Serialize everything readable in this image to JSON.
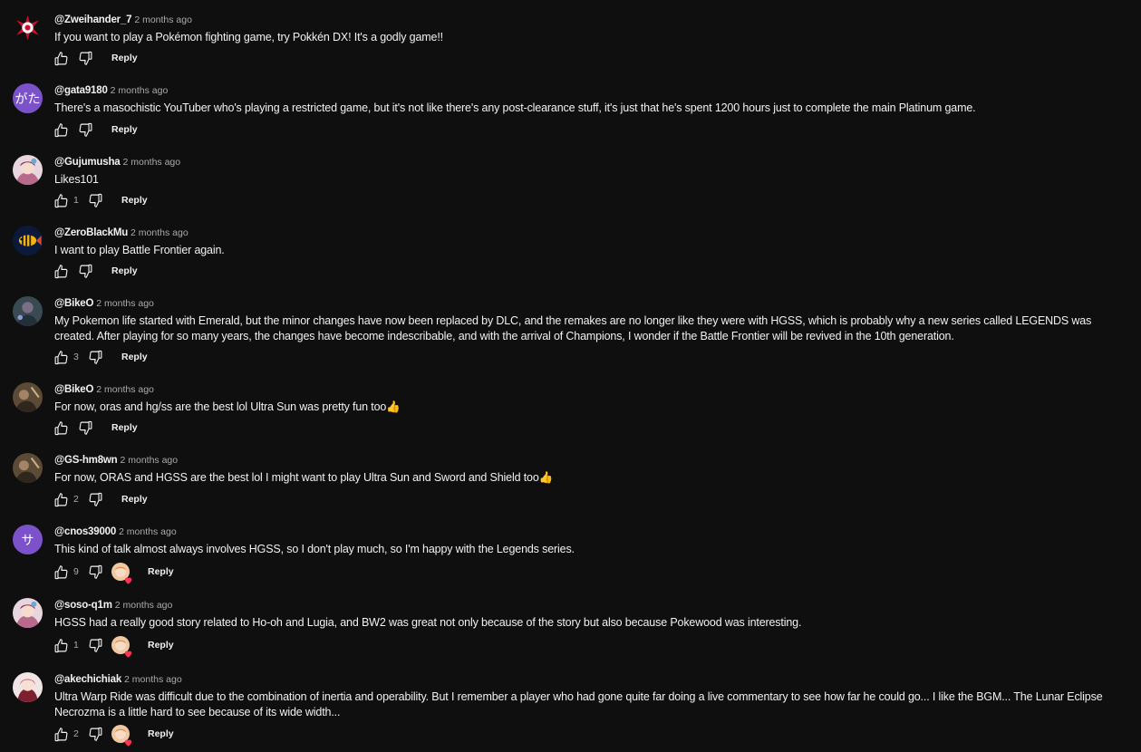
{
  "labels": {
    "reply": "Reply"
  },
  "colors": {
    "background": "#0f0f0f",
    "text": "#f1f1f1",
    "muted": "#aaaaaa",
    "avatar_purple": "#7b52c9",
    "heart_red": "#ff3355"
  },
  "comments": [
    {
      "author": "@Zweihander_7",
      "time": "2 months ago",
      "text": "If you want to play a Pokémon fighting game, try Pokkén DX! It's a godly game!!",
      "likes": "",
      "avatar": {
        "kind": "icon",
        "icon": "red-emblem-avatar"
      },
      "creator_heart": false
    },
    {
      "author": "@gata9180",
      "time": "2 months ago",
      "text": "There's a masochistic YouTuber who's playing a restricted game, but it's not like there's any post-clearance stuff, it's just that he's spent 1200 hours just to complete the main Platinum game.",
      "likes": "",
      "avatar": {
        "kind": "letter",
        "letter": "がた",
        "color": "#7b52c9"
      },
      "creator_heart": false
    },
    {
      "author": "@Gujumusha",
      "time": "2 months ago",
      "text": "Likes101",
      "likes": "1",
      "avatar": {
        "kind": "icon",
        "icon": "anime-avatar"
      },
      "creator_heart": false
    },
    {
      "author": "@ZeroBlackMu",
      "time": "2 months ago",
      "text": "I want to play Battle Frontier again.",
      "likes": "",
      "avatar": {
        "kind": "icon",
        "icon": "fish-avatar"
      },
      "creator_heart": false
    },
    {
      "author": "@BikeO",
      "time": "2 months ago",
      "text": "My Pokemon life started with Emerald, but the minor changes have now been replaced by DLC, and the remakes are no longer like they were with HGSS, which is probably why a new series called LEGENDS was created. After playing for so many years, the changes have become indescribable, and with the arrival of Champions, I wonder if the Battle Frontier will be revived in the 10th generation.",
      "likes": "3",
      "avatar": {
        "kind": "icon",
        "icon": "dark-figure-avatar"
      },
      "creator_heart": false
    },
    {
      "author": "@BikeO",
      "time": "2 months ago",
      "text": "For now, oras and hg/ss are the best lol Ultra Sun was pretty fun too👍",
      "likes": "",
      "avatar": {
        "kind": "icon",
        "icon": "brown-photo-avatar"
      },
      "creator_heart": false
    },
    {
      "author": "@GS-hm8wn",
      "time": "2 months ago",
      "text": "For now, ORAS and HGSS are the best lol I might want to play Ultra Sun and Sword and Shield too👍",
      "likes": "2",
      "avatar": {
        "kind": "icon",
        "icon": "brown-photo-avatar"
      },
      "creator_heart": false
    },
    {
      "author": "@cnos39000",
      "time": "2 months ago",
      "text": "This kind of talk almost always involves HGSS, so I don't play much, so I'm happy with the Legends series.",
      "likes": "9",
      "avatar": {
        "kind": "letter",
        "letter": "サ",
        "color": "#7b52c9"
      },
      "creator_heart": true
    },
    {
      "author": "@soso-q1m",
      "time": "2 months ago",
      "text": "HGSS had a really good story related to Ho-oh and Lugia, and BW2 was great not only because of the story but also because Pokewood was interesting.",
      "likes": "1",
      "avatar": {
        "kind": "icon",
        "icon": "anime-avatar"
      },
      "creator_heart": true
    },
    {
      "author": "@akechichiak",
      "time": "2 months ago",
      "text": "Ultra Warp Ride was difficult due to the combination of inertia and operability. But I remember a player who had gone quite far doing a live commentary to see how far he could go... I like the BGM... The Lunar Eclipse Necrozma is a little hard to see because of its wide width...",
      "likes": "2",
      "avatar": {
        "kind": "icon",
        "icon": "anime-girl-avatar"
      },
      "creator_heart": true
    }
  ]
}
